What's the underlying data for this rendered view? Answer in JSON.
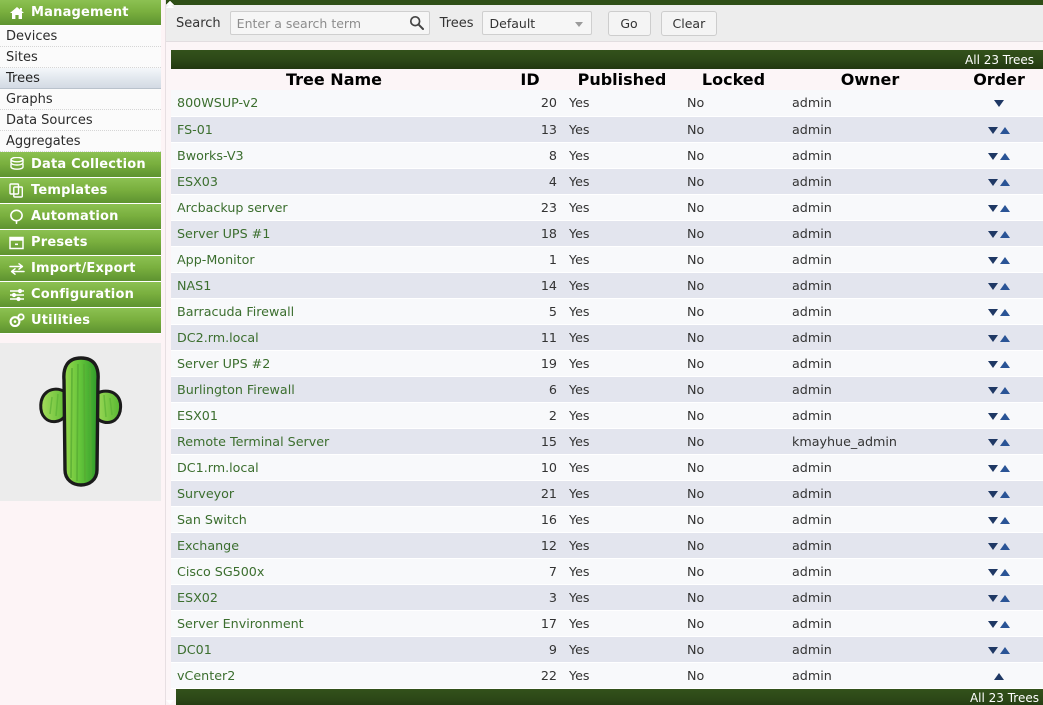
{
  "sidebar": {
    "sections": [
      {
        "label": "Management",
        "icon": "home-icon"
      },
      {
        "label": "Data Collection",
        "icon": "database-icon"
      },
      {
        "label": "Templates",
        "icon": "copy-icon"
      },
      {
        "label": "Automation",
        "icon": "lasso-icon"
      },
      {
        "label": "Presets",
        "icon": "box-icon"
      },
      {
        "label": "Import/Export",
        "icon": "exchange-icon"
      },
      {
        "label": "Configuration",
        "icon": "sliders-icon"
      },
      {
        "label": "Utilities",
        "icon": "gears-icon"
      }
    ],
    "management_items": [
      {
        "label": "Devices",
        "selected": false
      },
      {
        "label": "Sites",
        "selected": false
      },
      {
        "label": "Trees",
        "selected": true
      },
      {
        "label": "Graphs",
        "selected": false
      },
      {
        "label": "Data Sources",
        "selected": false
      },
      {
        "label": "Aggregates",
        "selected": false
      }
    ],
    "logo": "cactus-logo"
  },
  "toolbar": {
    "search_label": "Search",
    "search_value": "",
    "search_placeholder": "Enter a search term",
    "search_icon": "magnifier-icon",
    "trees_label": "Trees",
    "trees_selected": "Default",
    "trees_options": [
      "Default"
    ],
    "go_label": "Go",
    "clear_label": "Clear"
  },
  "table": {
    "title": "All 23 Trees",
    "footer": "All 23 Trees",
    "columns": [
      {
        "label": "Tree Name",
        "align": "left",
        "sortable": true,
        "active": false,
        "dir": "none"
      },
      {
        "label": "ID",
        "align": "right",
        "sortable": true,
        "active": false,
        "dir": "none"
      },
      {
        "label": "Published",
        "align": "left",
        "sortable": true,
        "active": false,
        "dir": "none"
      },
      {
        "label": "Locked",
        "align": "left",
        "sortable": true,
        "active": false,
        "dir": "none"
      },
      {
        "label": "Owner",
        "align": "left",
        "sortable": true,
        "active": false,
        "dir": "none"
      },
      {
        "label": "Order",
        "align": "center",
        "sortable": true,
        "active": true,
        "dir": "asc"
      }
    ],
    "rows": [
      {
        "name": "800WSUP-v2",
        "id": "20",
        "published": "Yes",
        "locked": "No",
        "owner": "admin",
        "order": "down"
      },
      {
        "name": "FS-01",
        "id": "13",
        "published": "Yes",
        "locked": "No",
        "owner": "admin",
        "order": "both"
      },
      {
        "name": "Bworks-V3",
        "id": "8",
        "published": "Yes",
        "locked": "No",
        "owner": "admin",
        "order": "both"
      },
      {
        "name": "ESX03",
        "id": "4",
        "published": "Yes",
        "locked": "No",
        "owner": "admin",
        "order": "both"
      },
      {
        "name": "Arcbackup server",
        "id": "23",
        "published": "Yes",
        "locked": "No",
        "owner": "admin",
        "order": "both"
      },
      {
        "name": "Server UPS #1",
        "id": "18",
        "published": "Yes",
        "locked": "No",
        "owner": "admin",
        "order": "both"
      },
      {
        "name": "App-Monitor",
        "id": "1",
        "published": "Yes",
        "locked": "No",
        "owner": "admin",
        "order": "both"
      },
      {
        "name": "NAS1",
        "id": "14",
        "published": "Yes",
        "locked": "No",
        "owner": "admin",
        "order": "both"
      },
      {
        "name": "Barracuda Firewall",
        "id": "5",
        "published": "Yes",
        "locked": "No",
        "owner": "admin",
        "order": "both"
      },
      {
        "name": "DC2.rm.local",
        "id": "11",
        "published": "Yes",
        "locked": "No",
        "owner": "admin",
        "order": "both"
      },
      {
        "name": "Server UPS #2",
        "id": "19",
        "published": "Yes",
        "locked": "No",
        "owner": "admin",
        "order": "both"
      },
      {
        "name": "Burlington Firewall",
        "id": "6",
        "published": "Yes",
        "locked": "No",
        "owner": "admin",
        "order": "both"
      },
      {
        "name": "ESX01",
        "id": "2",
        "published": "Yes",
        "locked": "No",
        "owner": "admin",
        "order": "both"
      },
      {
        "name": "Remote Terminal Server",
        "id": "15",
        "published": "Yes",
        "locked": "No",
        "owner": "kmayhue_admin",
        "order": "both"
      },
      {
        "name": "DC1.rm.local",
        "id": "10",
        "published": "Yes",
        "locked": "No",
        "owner": "admin",
        "order": "both"
      },
      {
        "name": "Surveyor",
        "id": "21",
        "published": "Yes",
        "locked": "No",
        "owner": "admin",
        "order": "both"
      },
      {
        "name": "San Switch",
        "id": "16",
        "published": "Yes",
        "locked": "No",
        "owner": "admin",
        "order": "both"
      },
      {
        "name": "Exchange",
        "id": "12",
        "published": "Yes",
        "locked": "No",
        "owner": "admin",
        "order": "both"
      },
      {
        "name": "Cisco SG500x",
        "id": "7",
        "published": "Yes",
        "locked": "No",
        "owner": "admin",
        "order": "both"
      },
      {
        "name": "ESX02",
        "id": "3",
        "published": "Yes",
        "locked": "No",
        "owner": "admin",
        "order": "both"
      },
      {
        "name": "Server Environment",
        "id": "17",
        "published": "Yes",
        "locked": "No",
        "owner": "admin",
        "order": "both"
      },
      {
        "name": "DC01",
        "id": "9",
        "published": "Yes",
        "locked": "No",
        "owner": "admin",
        "order": "both"
      },
      {
        "name": "vCenter2",
        "id": "22",
        "published": "Yes",
        "locked": "No",
        "owner": "admin",
        "order": "up"
      }
    ]
  },
  "colors": {
    "brand_green": "#7fb13d",
    "dark_green": "#2c4717",
    "link_green": "#3b6e2e",
    "row_alt": "#e3e5ee",
    "arrow_blue": "#1f3864"
  }
}
